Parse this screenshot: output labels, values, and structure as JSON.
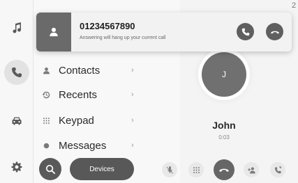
{
  "banner": {
    "number": "01234567890",
    "subtitle": "Answering will hang up your current call"
  },
  "corner_indicator": "2",
  "rail": {
    "items": [
      {
        "icon": "music-icon"
      },
      {
        "icon": "phone-icon",
        "active": true
      },
      {
        "icon": "car-icon"
      },
      {
        "icon": "gear-icon"
      }
    ]
  },
  "menu": {
    "items": [
      {
        "label": "Contacts",
        "icon": "person-icon"
      },
      {
        "label": "Recents",
        "icon": "history-icon"
      },
      {
        "label": "Keypad",
        "icon": "keypad-icon"
      },
      {
        "label": "Messages",
        "icon": "message-icon"
      }
    ],
    "chevron": "›"
  },
  "call": {
    "avatar_initial": "J",
    "name": "John",
    "duration": "0:03"
  },
  "bottom": {
    "devices_label": "Devices"
  },
  "colors": {
    "accent_dark": "#585858",
    "background": "#f4f4f4"
  }
}
